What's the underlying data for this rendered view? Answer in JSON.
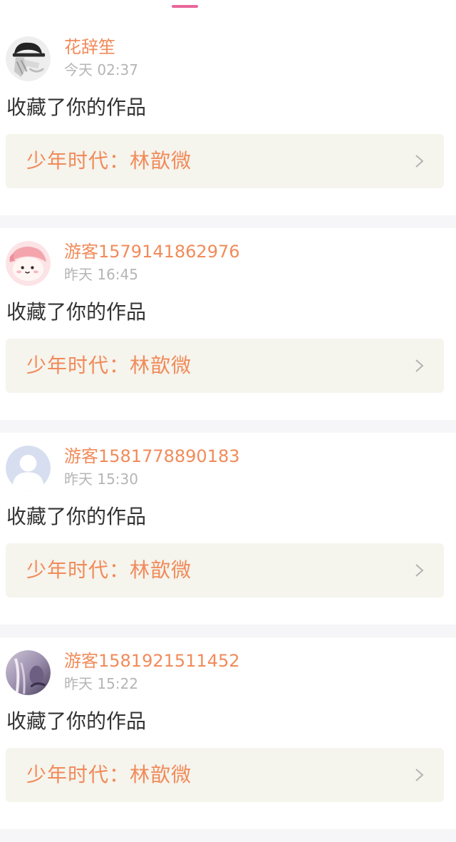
{
  "colors": {
    "accent": "#f18b5a",
    "tab_indicator": "#e9679a",
    "timestamp": "#b5b5b5",
    "action_text": "#333333",
    "work_box_bg": "#f5f4ed",
    "separator": "#f6f5f7"
  },
  "icons": {
    "chevron": "chevron-right-icon"
  },
  "notifications": [
    {
      "username": "花辞笙",
      "time": "今天 02:37",
      "action": "收藏了你的作品",
      "work_title": "少年时代：林歆微",
      "avatar": "cap-hand-avatar"
    },
    {
      "username": "游客1579141862976",
      "time": "昨天 16:45",
      "action": "收藏了你的作品",
      "work_title": "少年时代：林歆微",
      "avatar": "pink-cartoon-avatar"
    },
    {
      "username": "游客1581778890183",
      "time": "昨天 15:30",
      "action": "收藏了你的作品",
      "work_title": "少年时代：林歆微",
      "avatar": "default-user-avatar"
    },
    {
      "username": "游客1581921511452",
      "time": "昨天 15:22",
      "action": "收藏了你的作品",
      "work_title": "少年时代：林歆微",
      "avatar": "photo-avatar"
    }
  ]
}
